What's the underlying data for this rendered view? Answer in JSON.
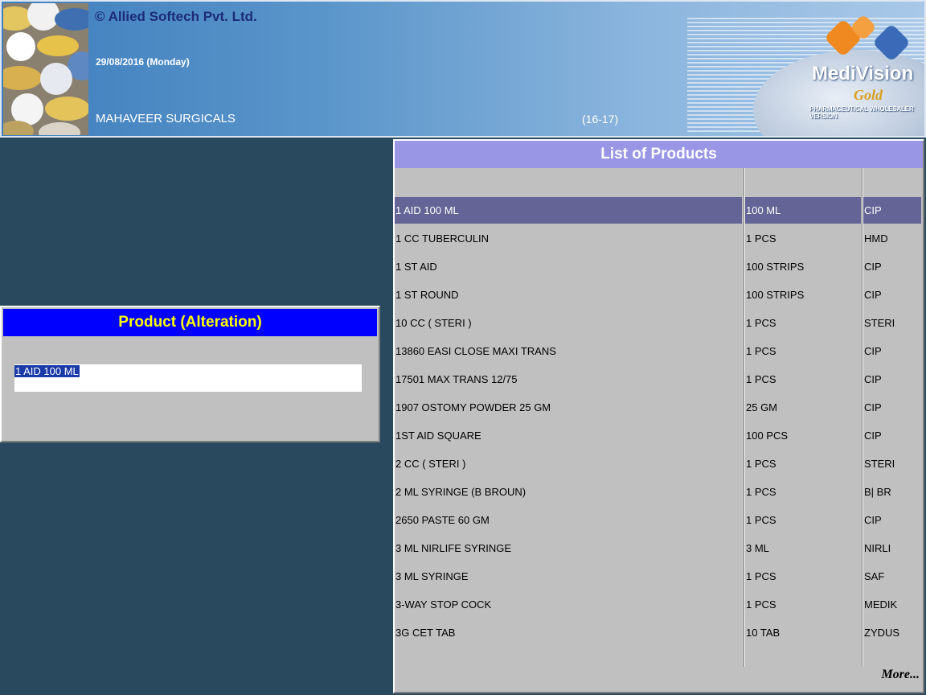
{
  "header": {
    "copyright": "© Allied Softech Pvt. Ltd.",
    "date": "29/08/2016 (Monday)",
    "company": "MAHAVEER SURGICALS",
    "year": "(16-17)",
    "logo": {
      "name": "MediVision",
      "edition": "Gold",
      "subtitle": "PHARMACEUTICAL WHOLESALER VERSION"
    }
  },
  "dialog": {
    "title": "Product (Alteration)",
    "input_value": "1 AID 100 ML"
  },
  "list": {
    "title": "List of Products",
    "more_label": "More...",
    "selected_index": 0,
    "rows": [
      {
        "name": "1 AID 100 ML",
        "pack": "100 ML",
        "company": "CIP"
      },
      {
        "name": "1 CC TUBERCULIN",
        "pack": "1 PCS",
        "company": "HMD"
      },
      {
        "name": "1 ST AID",
        "pack": "100 STRIPS",
        "company": "CIP"
      },
      {
        "name": "1 ST ROUND",
        "pack": "100 STRIPS",
        "company": "CIP"
      },
      {
        "name": "10 CC ( STERI )",
        "pack": "1 PCS",
        "company": "STERI"
      },
      {
        "name": "13860 EASI CLOSE MAXI TRANS",
        "pack": "1 PCS",
        "company": "CIP"
      },
      {
        "name": "17501 MAX TRANS 12/75",
        "pack": "1 PCS",
        "company": "CIP"
      },
      {
        "name": "1907 OSTOMY POWDER 25 GM",
        "pack": "25 GM",
        "company": "CIP"
      },
      {
        "name": "1ST AID SQUARE",
        "pack": "100 PCS",
        "company": "CIP"
      },
      {
        "name": "2 CC ( STERI )",
        "pack": "1 PCS",
        "company": "STERI"
      },
      {
        "name": "2 ML SYRINGE (B BROUN)",
        "pack": "1 PCS",
        "company": "B| BR"
      },
      {
        "name": "2650 PASTE 60 GM",
        "pack": "1 PCS",
        "company": "CIP"
      },
      {
        "name": "3 ML NIRLIFE SYRINGE",
        "pack": "3 ML",
        "company": "NIRLI"
      },
      {
        "name": "3 ML SYRINGE",
        "pack": "1 PCS",
        "company": "SAF"
      },
      {
        "name": "3-WAY STOP COCK",
        "pack": "1 PCS",
        "company": "MEDIK"
      },
      {
        "name": "3G CET TAB",
        "pack": "10 TAB",
        "company": "ZYDUS"
      }
    ]
  },
  "colors": {
    "background": "#294a5e",
    "dialog_title_bg": "#0000ff",
    "dialog_title_text": "#ffff00",
    "list_title_bg": "#9a96e6",
    "selected_row_bg": "#646496"
  }
}
